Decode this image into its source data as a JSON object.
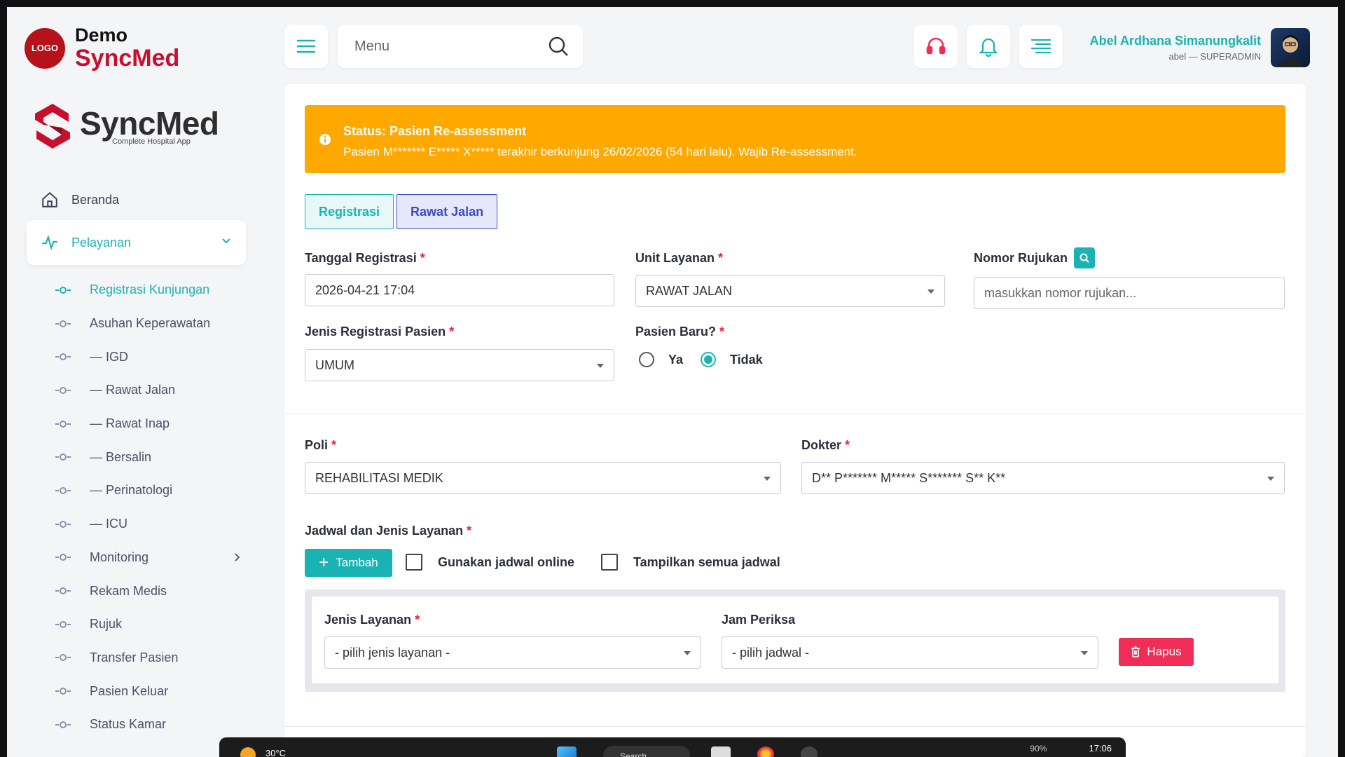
{
  "app": {
    "logo_badge": "LOGO",
    "logo_demo": "Demo",
    "logo_name": "SyncMed",
    "brand_name": "SyncMed",
    "brand_tagline": "Complete Hospital App"
  },
  "sidebar": {
    "home": "Beranda",
    "section": "Pelayanan",
    "items": [
      {
        "label": "Registrasi Kunjungan"
      },
      {
        "label": "Asuhan Keperawatan"
      },
      {
        "label": "— IGD"
      },
      {
        "label": "— Rawat Jalan"
      },
      {
        "label": "— Rawat Inap"
      },
      {
        "label": "— Bersalin"
      },
      {
        "label": "— Perinatologi"
      },
      {
        "label": "— ICU"
      },
      {
        "label": "Monitoring"
      },
      {
        "label": "Rekam Medis"
      },
      {
        "label": "Rujuk"
      },
      {
        "label": "Transfer Pasien"
      },
      {
        "label": "Pasien Keluar"
      },
      {
        "label": "Status Kamar"
      }
    ]
  },
  "topbar": {
    "search_placeholder": "Menu",
    "user_name": "Abel Ardhana Simanungkalit",
    "user_role": "abel — SUPERADMIN"
  },
  "alert": {
    "title": "Status: Pasien Re-assessment",
    "message": "Pasien M******* E***** X***** terakhir berkunjung 26/02/2026 (54 hari lalu). Wajib Re-assessment."
  },
  "tabs": {
    "registrasi": "Registrasi",
    "rawat_jalan": "Rawat Jalan"
  },
  "form": {
    "tanggal_label": "Tanggal Registrasi",
    "tanggal_value": "2026-04-21 17:04",
    "unit_label": "Unit Layanan",
    "unit_value": "RAWAT JALAN",
    "rujukan_label": "Nomor Rujukan",
    "rujukan_placeholder": "masukkan nomor rujukan...",
    "jenis_label": "Jenis Registrasi Pasien",
    "jenis_value": "UMUM",
    "baru_label": "Pasien Baru?",
    "baru_ya": "Ya",
    "baru_tidak": "Tidak",
    "poli_label": "Poli",
    "poli_value": "REHABILITASI MEDIK",
    "dokter_label": "Dokter",
    "dokter_value": "D** P******* M***** S******* S** K**",
    "jadwal_label": "Jadwal dan Jenis Layanan",
    "add_button": "Tambah",
    "check_online": "Gunakan jadwal online",
    "check_all": "Tampilkan semua jadwal",
    "layanan_label": "Jenis Layanan",
    "layanan_value": "- pilih jenis layanan -",
    "jam_label": "Jam Periksa",
    "jam_value": "- pilih jadwal -",
    "delete_button": "Hapus"
  },
  "taskbar": {
    "temperature": "30°C",
    "search": "Search",
    "battery": "90%",
    "time": "17:06"
  },
  "colors": {
    "accent": "#1ab3b3",
    "brand": "#c8102e",
    "warning": "#ffa800",
    "danger": "#ef2d56",
    "secondary_tab": "#3b4cc0"
  }
}
